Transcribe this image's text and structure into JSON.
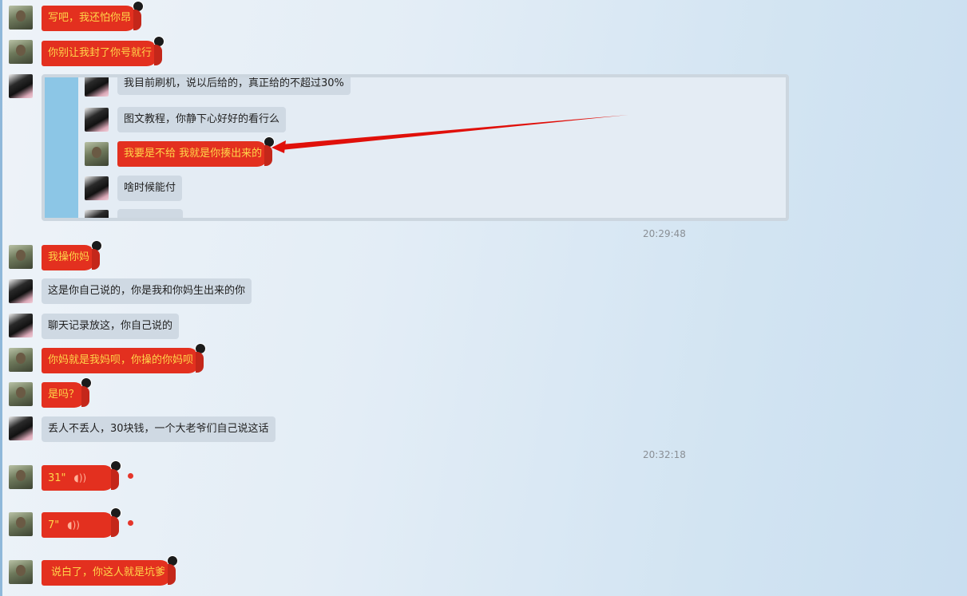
{
  "messages": {
    "m1": "写吧，我还怕你昂",
    "m2": "你别让我封了你号就行",
    "m3": "我操你妈",
    "m4": "这是你自己说的，你是我和你妈生出来的你",
    "m5": "聊天记录放这，你自己说的",
    "m6": "你妈就是我妈呗，你操的你妈呗",
    "m7": "是吗？",
    "m8": "丢人不丢人，30块钱，一个大老爷们自己说这话",
    "m9": "说白了，你这人就是坑爹"
  },
  "quoted": {
    "q1": "我目前刷机，说以后给的，真正给的不超过30%",
    "q2": "图文教程，你静下心好好的看行么",
    "q3": "我要是不给  我就是你揍出来的",
    "q4": "啥时候能付"
  },
  "times": {
    "t1": "20:29:48",
    "t2": "20:32:18"
  },
  "voice": {
    "v1": "31\"",
    "v2": "7\""
  },
  "colors": {
    "my_bubble": "#e3301f",
    "my_text": "#ffd54a",
    "other_bubble": "#cfd9e3",
    "arrow": "#e0100a"
  }
}
